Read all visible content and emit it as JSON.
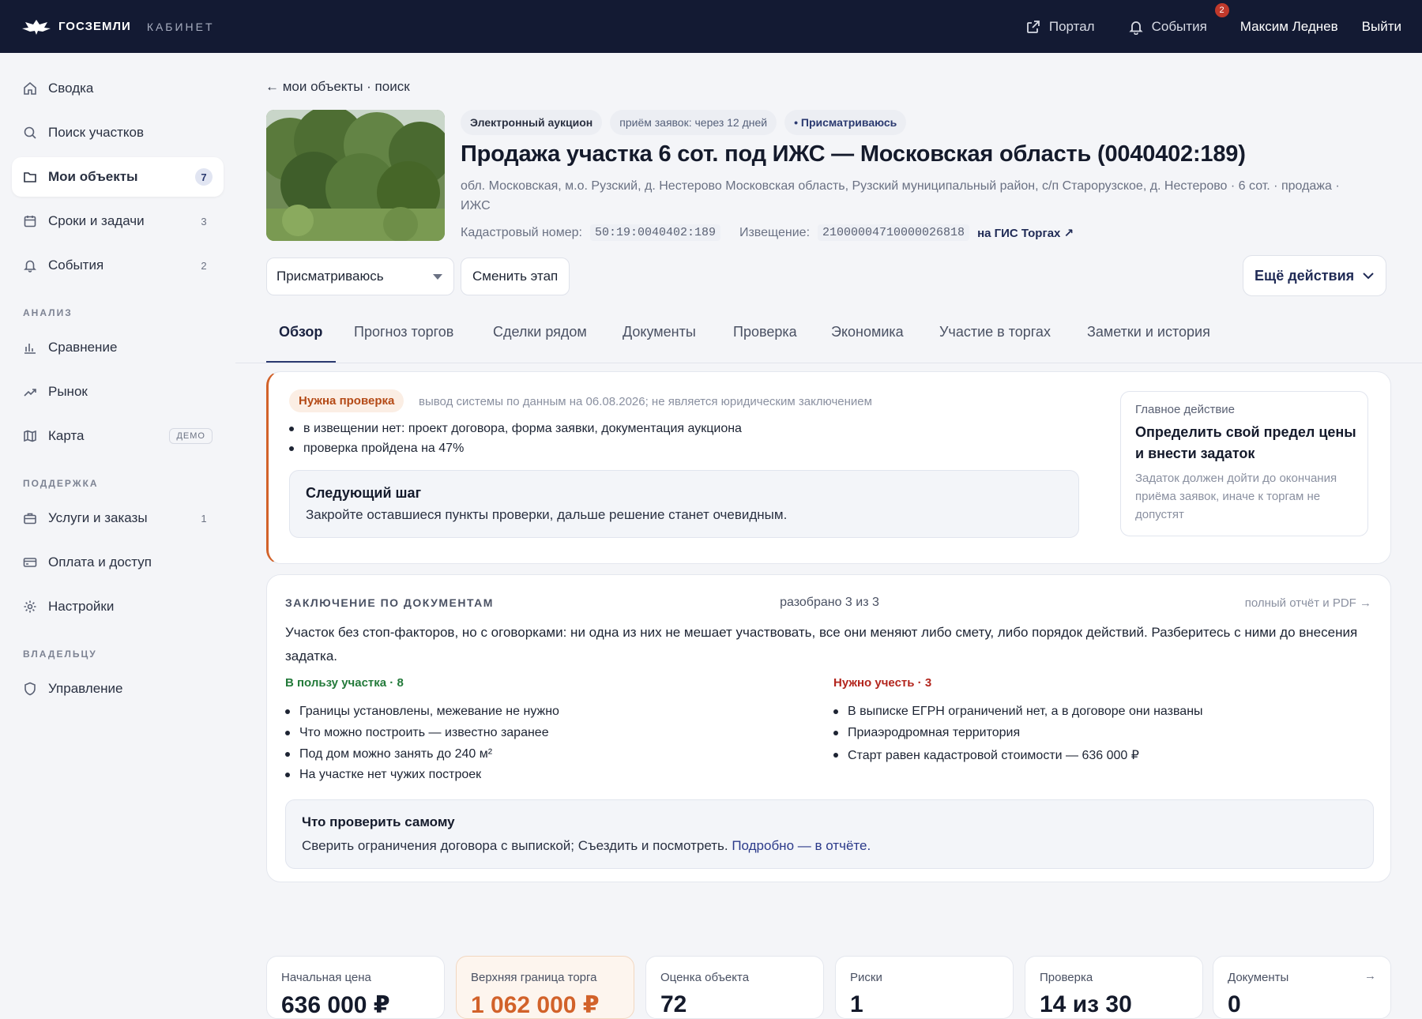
{
  "topbar": {
    "brand": "ГОСЗЕМЛИ",
    "section": "КАБИНЕТ",
    "portal": "Портал",
    "events": "События",
    "events_badge": "2",
    "user": "Максим Леднев",
    "logout": "Выйти"
  },
  "sidebar": {
    "items": [
      {
        "label": "Сводка",
        "icon": "home-icon"
      },
      {
        "label": "Поиск участков",
        "icon": "search-icon"
      },
      {
        "label": "Мои объекты",
        "icon": "folder-icon",
        "count": "7"
      },
      {
        "label": "Сроки и задачи",
        "icon": "calendar-icon",
        "count": "3"
      },
      {
        "label": "События",
        "icon": "bell-icon",
        "count": "2"
      },
      {
        "label": "Сравнение",
        "icon": "bar-chart-icon"
      },
      {
        "label": "Рынок",
        "icon": "trend-icon"
      },
      {
        "label": "Карта",
        "icon": "map-icon",
        "tag": "ДЕМО"
      },
      {
        "label": "Услуги и заказы",
        "icon": "briefcase-icon",
        "count": "1"
      },
      {
        "label": "Оплата и доступ",
        "icon": "card-icon"
      },
      {
        "label": "Настройки",
        "icon": "gear-icon"
      },
      {
        "label": "Управление",
        "icon": "shield-icon"
      }
    ],
    "sections": {
      "analysis": "АНАЛИЗ",
      "support": "ПОДДЕРЖКА",
      "owner": "ВЛАДЕЛЬЦУ"
    }
  },
  "header": {
    "back": "← мои объекты · поиск",
    "chips": [
      "Электронный аукцион",
      "приём заявок: через 12 дней",
      "• Присматриваюсь"
    ],
    "title": "Продажа участка 6 сот. под ИЖС — Московская область (0040402:189)",
    "address": "обл. Московская, м.о. Рузский, д. Нестерово Московская область, Рузский муниципальный район, с/п Старорузское, д. Нестерово · 6 сот. · продажа · ИЖС",
    "cadastral_label": "Кадастровый номер:",
    "cadastral_value": "50:19:0040402:189",
    "notice_label": "Извещение:",
    "notice_value": "21000004710000026818",
    "gis_link": "на ГИС Торгах ↗",
    "stage_select": "Присматриваюсь",
    "change_stage": "Сменить этап",
    "more_actions": "Ещё действия"
  },
  "tabs": [
    "Обзор",
    "Прогноз торгов",
    "Сделки рядом",
    "Документы",
    "Проверка",
    "Экономика",
    "Участие в торгах",
    "Заметки и история"
  ],
  "status_card": {
    "tag": "Нужна проверка",
    "note": "вывод системы по данным на 06.08.2026; не является юридическим заключением",
    "bullets": [
      "в извещении нет: проект договора, форма заявки, документация аукциона",
      "проверка пройдена на 47%"
    ],
    "next_title": "Следующий шаг",
    "next_text": "Закройте оставшиеся пункты проверки, дальше решение станет очевидным.",
    "main_label": "Главное действие",
    "main_title": "Определить свой предел цены и внести задаток",
    "main_desc": "Задаток должен дойти до окончания приёма заявок, иначе к торгам не допустят"
  },
  "docs_card": {
    "heading": "ЗАКЛЮЧЕНИЕ ПО ДОКУМЕНТАМ",
    "parsed": "разобрано 3 из 3",
    "report_link": "полный отчёт и PDF →",
    "summary": "Участок без стоп-факторов, но с оговорками: ни одна из них не мешает участвовать, все они меняют либо смету, либо порядок действий. Разберитесь с ними до внесения задатка.",
    "pros_heading": "В пользу участка · 8",
    "pros": [
      "Границы установлены, межевание не нужно",
      "Что можно построить — известно заранее",
      "Под дом можно занять до 240 м²",
      "На участке нет чужих построек"
    ],
    "cons_heading": "Нужно учесть · 3",
    "cons": [
      "В выписке ЕГРН ограничений нет, а в договоре они названы",
      "Приаэродромная территория",
      "Старт равен кадастровой стоимости — 636 000 ₽"
    ],
    "check_title": "Что проверить самому",
    "check_text": "Сверить ограничения договора с выпиской; Съездить и посмотреть.",
    "check_link": "Подробно — в отчёте."
  },
  "kpis": [
    {
      "label": "Начальная цена",
      "value": "636 000 ₽"
    },
    {
      "label": "Верхняя граница торга",
      "value": "1 062 000 ₽"
    },
    {
      "label": "Оценка объекта",
      "value": "72"
    },
    {
      "label": "Риски",
      "value": "1"
    },
    {
      "label": "Проверка",
      "value": "14 из 30"
    },
    {
      "label": "Документы",
      "value": "0",
      "arrow": "→"
    }
  ],
  "colors": {
    "topbar": "#131a33",
    "accent": "#2b3a70",
    "warning": "#d2622a",
    "positive": "#237a3a",
    "negative": "#b3261e"
  }
}
